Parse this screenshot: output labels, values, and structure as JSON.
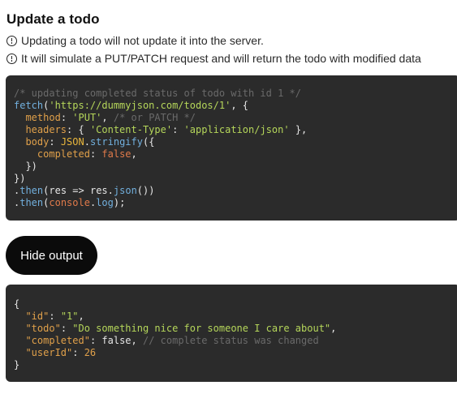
{
  "section": {
    "title": "Update a todo",
    "notes": [
      "Updating a todo will not update it into the server.",
      "It will simulate a PUT/PATCH request and will return the todo with modified data"
    ]
  },
  "request_code": {
    "comment": "/* updating completed status of todo with id 1 */",
    "fetch": "fetch",
    "url": "'https://dummyjson.com/todos/1'",
    "method_key": "method",
    "method_value": "'PUT'",
    "method_comment": "/* or PATCH */",
    "headers_key": "headers",
    "content_type_key": "'Content-Type'",
    "content_type_value": "'application/json'",
    "body_key": "body",
    "json": "JSON",
    "stringify": "stringify",
    "completed_key": "completed",
    "completed_value": "false",
    "then1": "then",
    "res1": "res",
    "res2": "res",
    "json_method": "json",
    "then2": "then",
    "console": "console",
    "log": "log"
  },
  "toggle_button": {
    "label": "Hide output"
  },
  "output_code": {
    "id_key": "\"id\"",
    "id_value": "\"1\"",
    "todo_key": "\"todo\"",
    "todo_value": "\"Do something nice for someone I care about\"",
    "completed_key": "\"completed\"",
    "completed_value": "false",
    "completed_comment": "// complete status was changed",
    "userid_key": "\"userId\"",
    "userid_value": "26"
  }
}
